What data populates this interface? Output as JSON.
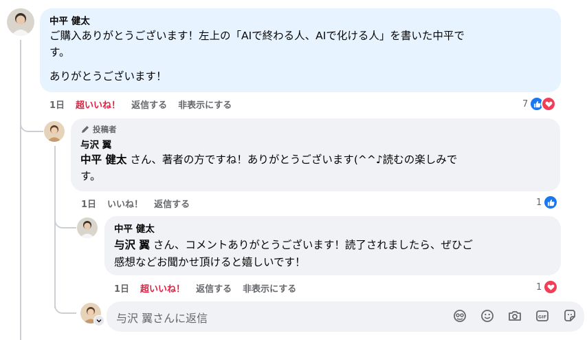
{
  "comment": {
    "author": "中平 健太",
    "lines": [
      "ご購入ありがとうございます！左上の「AIで終わる人、AIで化ける人」を書いた中平で",
      "す。"
    ],
    "line2": "ありがとうございます！",
    "time": "1日",
    "like_label": "超いいね！",
    "reply_label": "返信する",
    "hide_label": "非表示にする",
    "reaction_count": "7"
  },
  "reply1": {
    "badge": "投稿者",
    "author": "与沢 翼",
    "mention": "中平 健太",
    "text_a": " さん、著者の方ですね！ありがとうございます(^^♪読むの楽しみで",
    "text_b": "す。",
    "time": "1日",
    "like_label": "いいね！",
    "reply_label": "返信する",
    "reaction_count": "1"
  },
  "reply2": {
    "author": "中平 健太",
    "mention": "与沢 翼",
    "text_a": " さん、コメントありがとうございます！読了されましたら、ぜひご",
    "text_b": "感想などお聞かせ頂けると嬉しいです！",
    "time": "1日",
    "like_label": "超いいね！",
    "reply_label": "返信する",
    "hide_label": "非表示にする",
    "reaction_count": "1"
  },
  "composer": {
    "placeholder": "与沢 翼さんに返信"
  },
  "icons": {
    "like": "thumbs-up-icon",
    "love": "heart-icon",
    "author_badge": "pencil-icon",
    "tools": [
      "avatar-sticker-icon",
      "emoji-icon",
      "camera-icon",
      "gif-icon",
      "sticker-icon"
    ]
  },
  "colors": {
    "main_bubble": "#e7f3ff",
    "reply_bubble": "#f0f2f5",
    "like_blue": "#1877f2",
    "love_red": "#f33e58",
    "super_like_text": "#e41e3f"
  }
}
